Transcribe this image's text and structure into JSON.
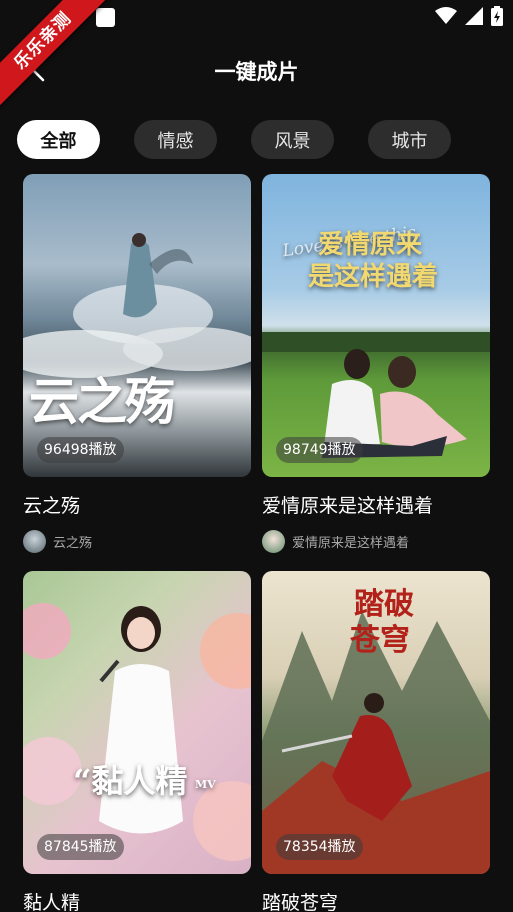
{
  "ribbon": {
    "label": "乐乐亲测"
  },
  "header": {
    "title": "一键成片"
  },
  "tabs": [
    {
      "label": "全部",
      "active": true
    },
    {
      "label": "情感",
      "active": false
    },
    {
      "label": "风景",
      "active": false
    },
    {
      "label": "城市",
      "active": false
    }
  ],
  "cards": [
    {
      "title": "云之殇",
      "plays": "96498播放",
      "author": "云之殇",
      "poster_text": "云之殇"
    },
    {
      "title": "爱情原来是这样遇着",
      "plays": "98749播放",
      "author": "爱情原来是这样遇着",
      "poster_line1": "爱情原来",
      "poster_line2": "是这样遇着",
      "poster_script": "Love is like this"
    },
    {
      "title": "黏人精",
      "plays": "87845播放",
      "author": "",
      "poster_text": "“黏人精",
      "poster_tag": "MV"
    },
    {
      "title": "踏破苍穹",
      "plays": "78354播放",
      "author": "",
      "poster_line1": "踏破",
      "poster_line2": "苍穹"
    }
  ],
  "icons": [
    "back-arrow-icon",
    "wifi-icon",
    "signal-icon",
    "battery-icon"
  ]
}
